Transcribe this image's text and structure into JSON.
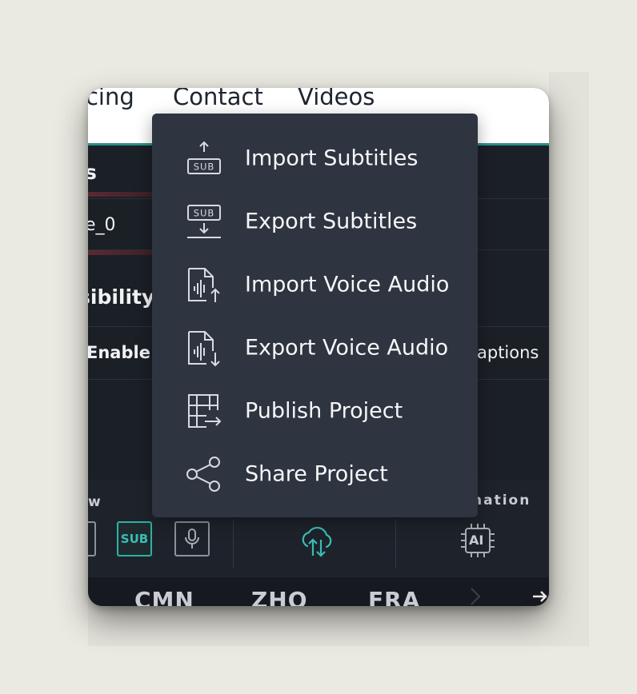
{
  "nav": {
    "items": [
      "Pricing",
      "Contact",
      "Videos"
    ]
  },
  "panel": {
    "section_title_partial": "s",
    "field_value_partial": "e_0",
    "accessibility_heading_partial": "sibility",
    "enable_label_partial": "Enable A",
    "captions_partial": "aptions"
  },
  "toolbar": {
    "left_label_partial": "w",
    "right_label_partial": "nation",
    "sub_badge": "SUB",
    "ai_badge": "AI"
  },
  "languages": [
    "CMN",
    "ZHO",
    "FRA"
  ],
  "menu": {
    "items": [
      {
        "label": "Import Subtitles",
        "icon": "import-subtitles-icon"
      },
      {
        "label": "Export Subtitles",
        "icon": "export-subtitles-icon"
      },
      {
        "label": "Import Voice Audio",
        "icon": "import-audio-icon"
      },
      {
        "label": "Export Voice Audio",
        "icon": "export-audio-icon"
      },
      {
        "label": "Publish Project",
        "icon": "publish-icon"
      },
      {
        "label": "Share Project",
        "icon": "share-icon"
      }
    ]
  },
  "colors": {
    "accent": "#2a8f8a",
    "menu_bg": "#2e3440",
    "app_bg": "#1b1f26"
  }
}
